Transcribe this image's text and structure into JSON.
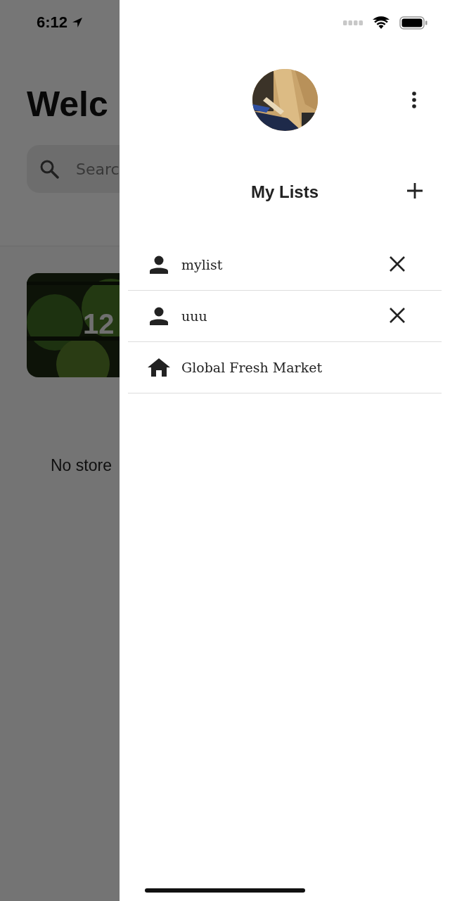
{
  "status_bar": {
    "time": "6:12"
  },
  "home": {
    "title": "Welc",
    "search": {
      "placeholder": "Searc"
    },
    "card": {
      "kind": "picture",
      "label": "12"
    },
    "empty_message": "No store"
  },
  "drawer": {
    "header": "My Lists",
    "lists": [
      {
        "name": "mylist",
        "kind": "personal",
        "removable": true
      },
      {
        "name": "uuu",
        "kind": "personal",
        "removable": true
      },
      {
        "name": "Global Fresh Market",
        "kind": "store",
        "removable": false
      }
    ]
  }
}
